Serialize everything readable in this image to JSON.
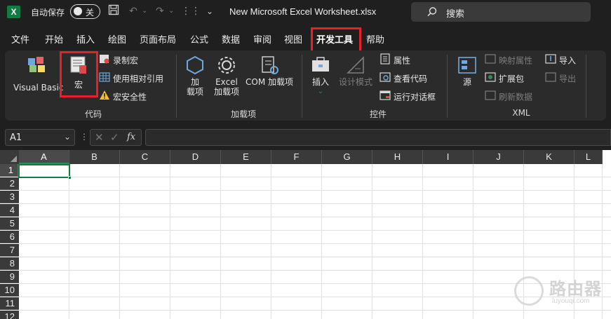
{
  "titlebar": {
    "logo_letter": "X",
    "autosave_label": "自动保存",
    "autosave_state": "关",
    "document_title": "New Microsoft Excel Worksheet.xlsx",
    "search_placeholder": "搜索"
  },
  "tabs": [
    "文件",
    "开始",
    "插入",
    "绘图",
    "页面布局",
    "公式",
    "数据",
    "审阅",
    "视图",
    "开发工具",
    "帮助"
  ],
  "active_tab": "开发工具",
  "ribbon": {
    "code": {
      "label": "代码",
      "visual_basic": "Visual Basic",
      "macros": "宏",
      "record_macro": "录制宏",
      "relative_refs": "使用相对引用",
      "macro_security": "宏安全性"
    },
    "addins": {
      "label": "加载项",
      "addins_line1": "加",
      "addins_line2": "载项",
      "excel_addins_line1": "Excel",
      "excel_addins_line2": "加载项",
      "com_addins": "COM 加载项"
    },
    "controls": {
      "label": "控件",
      "insert": "插入",
      "design_mode": "设计模式",
      "properties": "属性",
      "view_code": "查看代码",
      "run_dialog": "运行对话框"
    },
    "xml": {
      "label": "XML",
      "source": "源",
      "map_properties": "映射属性",
      "expansion_packs": "扩展包",
      "refresh_data": "刷新数据",
      "import": "导入",
      "export": "导出"
    }
  },
  "formula_bar": {
    "name_box": "A1",
    "fx": "fx",
    "formula_value": ""
  },
  "grid": {
    "columns": [
      "A",
      "B",
      "C",
      "D",
      "E",
      "F",
      "G",
      "H",
      "I",
      "J",
      "K",
      "L"
    ],
    "rows": [
      "1",
      "2",
      "3",
      "4",
      "5",
      "6",
      "7",
      "8",
      "9",
      "10",
      "11",
      "12"
    ],
    "active_cell": "A1"
  },
  "watermark": {
    "text": "路由器",
    "url": "luyouqi.com"
  },
  "colors": {
    "excel_green": "#107c41",
    "highlight_red": "#e8202a",
    "dark_bg": "#1f1f1f",
    "ribbon_bg": "#2b2b2b"
  }
}
